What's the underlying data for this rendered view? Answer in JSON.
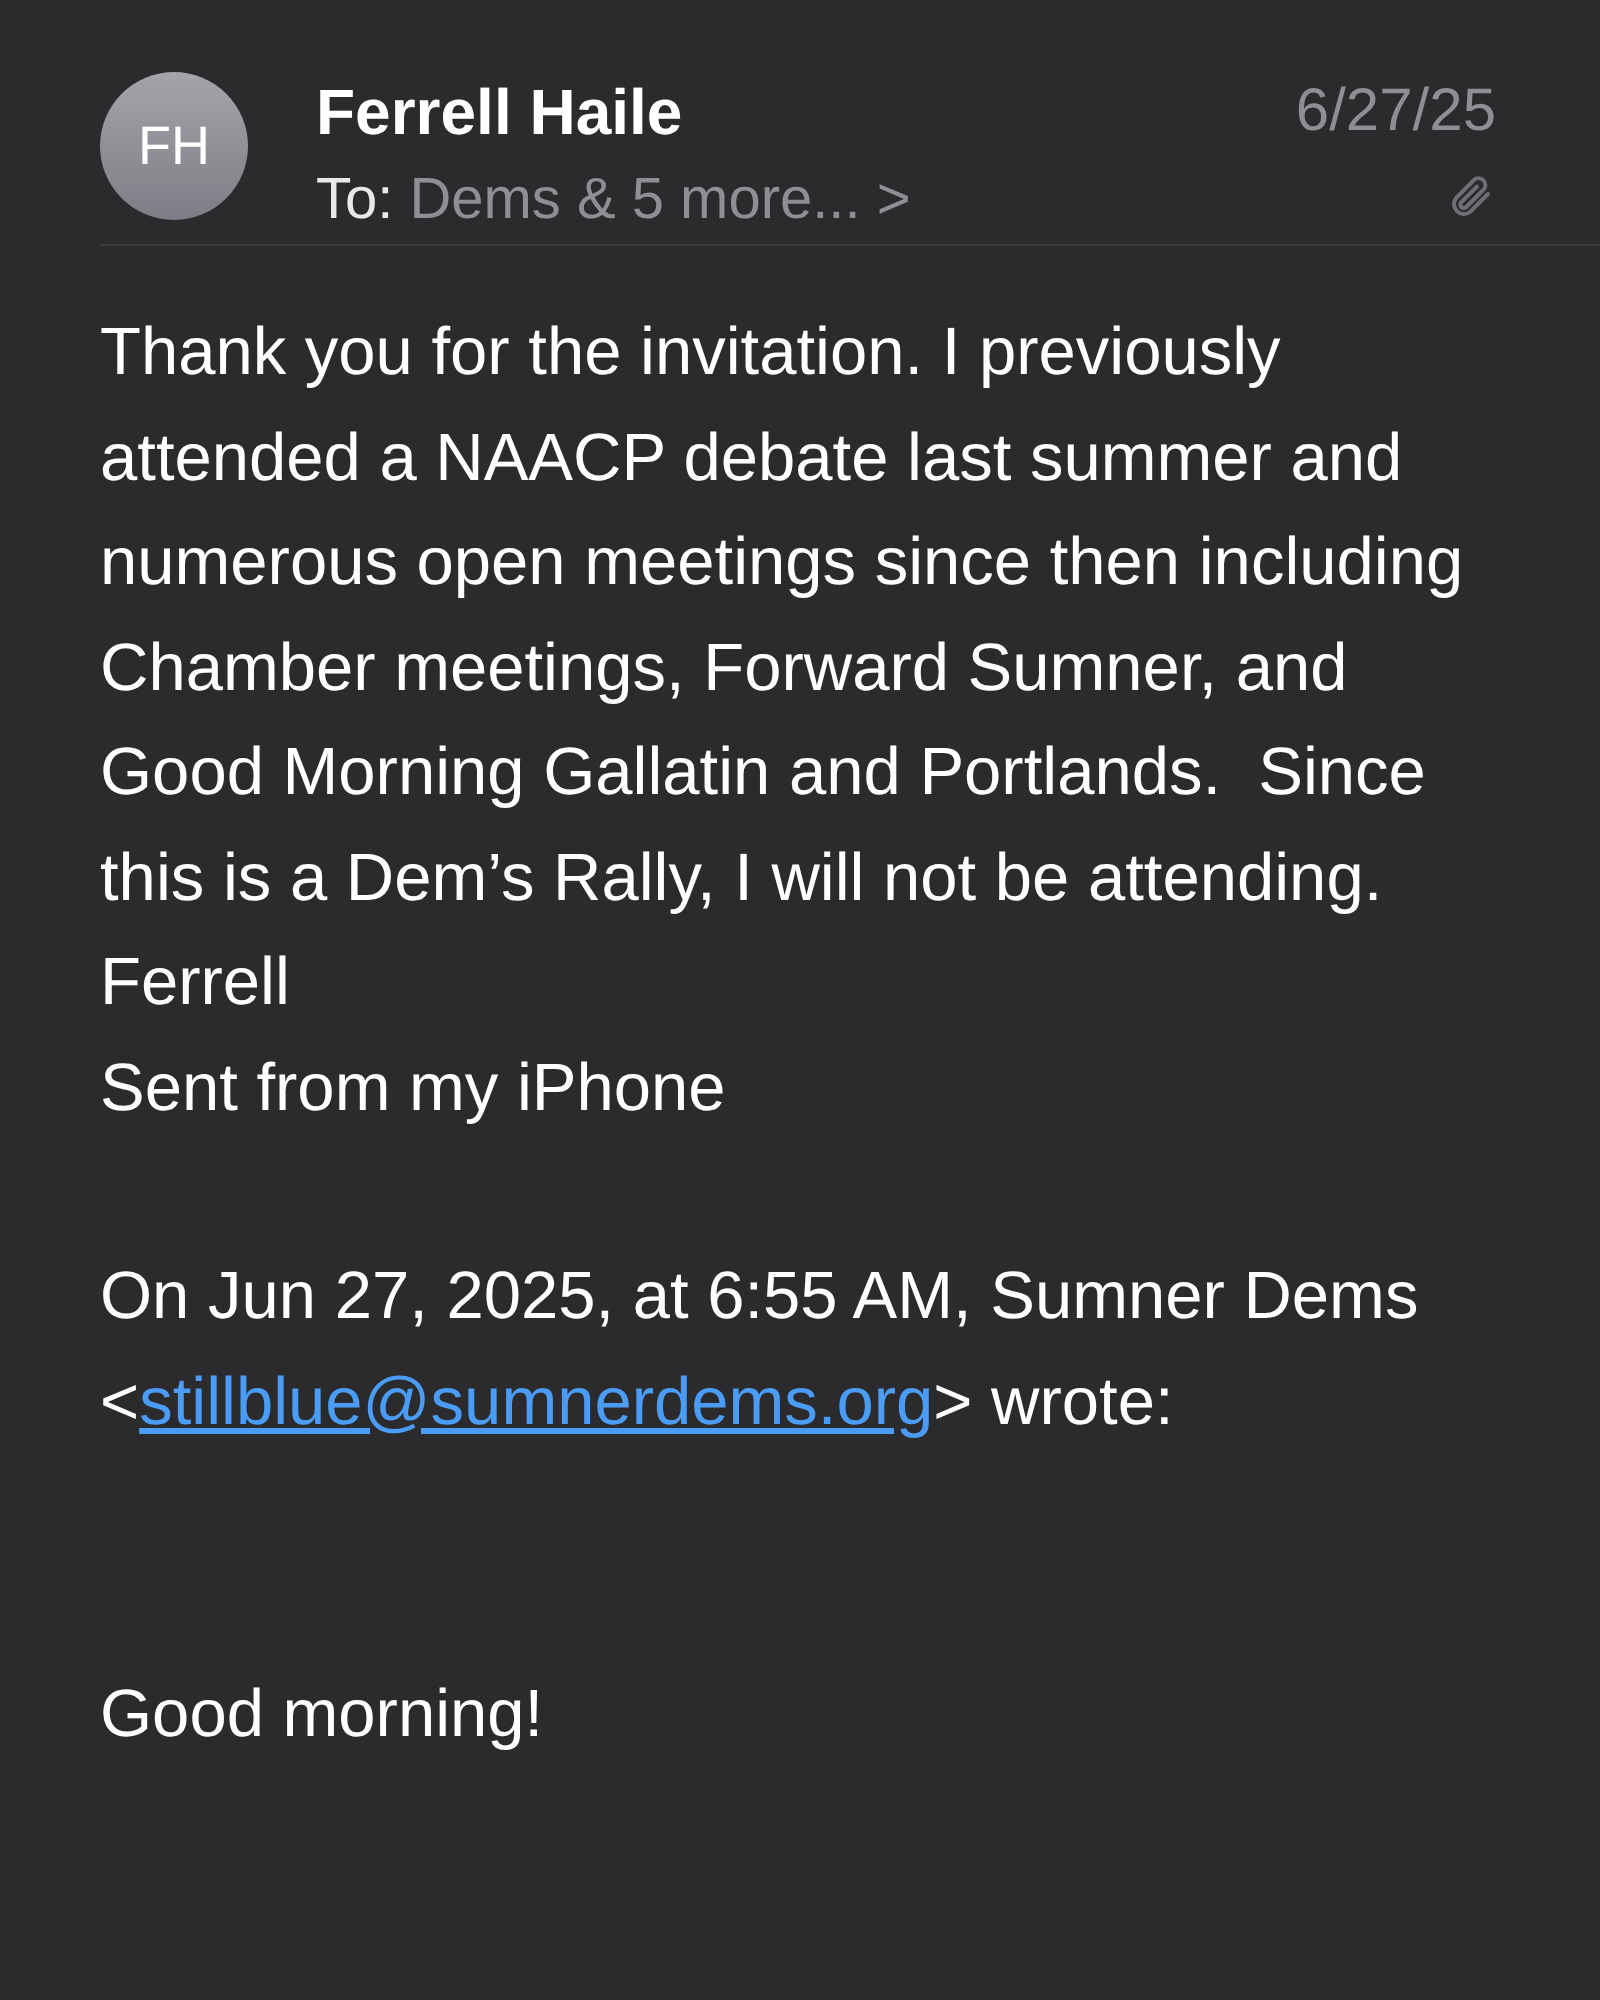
{
  "header": {
    "avatar_initials": "FH",
    "sender": "Ferrell Haile",
    "to_label": "To:",
    "recipients": "Dems & 5 more...",
    "chevron": ">",
    "date": "6/27/25",
    "has_attachment": true
  },
  "body": {
    "paragraph": "Thank you for the invitation. I previously attended a NAACP debate last summer and numerous open meetings since then including Chamber meetings, Forward Sumner, and Good Morning Gallatin and Portlands.  Since this is a Dem’s Rally, I will not be attending.",
    "signature": "Ferrell",
    "sent_from": "Sent from my iPhone",
    "quote_prefix": "On Jun 27, 2025, at 6:55 AM, Sumner Dems <",
    "quote_link": "stillblue@sumnerdems.org",
    "quote_suffix": "> wrote:",
    "greeting": "Good morning!"
  }
}
